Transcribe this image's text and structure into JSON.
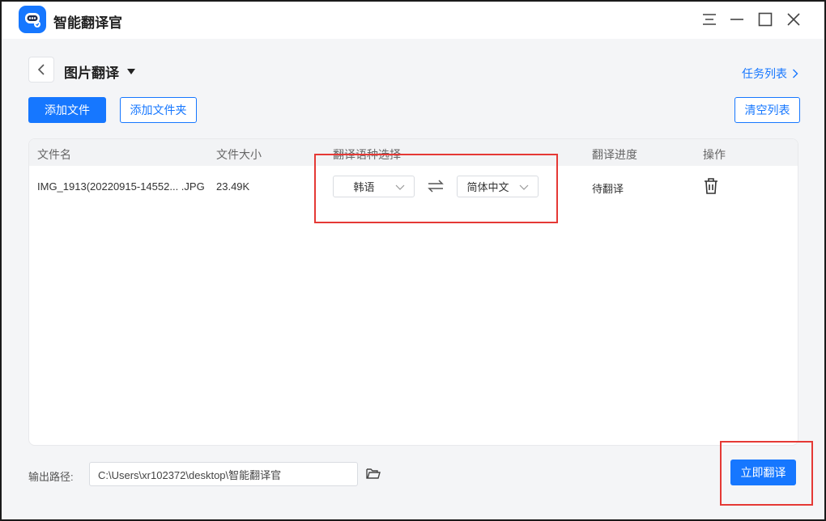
{
  "window": {
    "app_title": "智能翻译官"
  },
  "header": {
    "page_title": "图片翻译",
    "task_list_link": "任务列表"
  },
  "toolbar": {
    "add_file": "添加文件",
    "add_folder": "添加文件夹",
    "clear_list": "清空列表"
  },
  "table": {
    "columns": {
      "filename": "文件名",
      "filesize": "文件大小",
      "language": "翻译语种选择",
      "progress": "翻译进度",
      "action": "操作"
    },
    "rows": [
      {
        "filename": "IMG_1913(20220915-14552... .JPG",
        "filesize": "23.49K",
        "source_lang": "韩语",
        "target_lang": "简体中文",
        "status": "待翻译"
      }
    ]
  },
  "footer": {
    "output_label": "输出路径:",
    "output_path": "C:\\Users\\xr102372\\desktop\\智能翻译官",
    "translate_now": "立即翻译"
  },
  "colors": {
    "accent": "#1677ff",
    "highlight": "#e53935"
  }
}
